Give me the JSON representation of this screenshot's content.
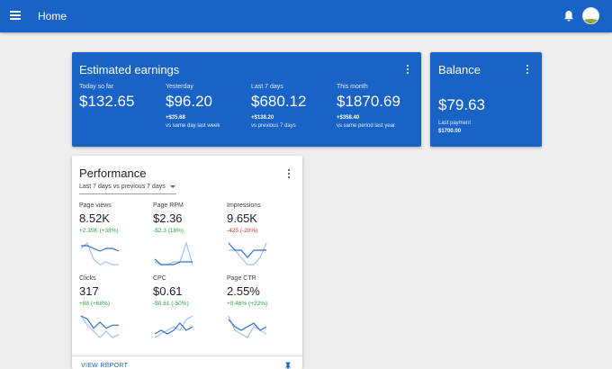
{
  "header": {
    "title": "Home"
  },
  "earnings": {
    "title": "Estimated earnings",
    "stats": [
      {
        "label": "Today so far",
        "value": "$132.65",
        "delta": "",
        "compare": ""
      },
      {
        "label": "Yesterday",
        "value": "$96.20",
        "delta": "+$35.68",
        "compare": "vs same day last week"
      },
      {
        "label": "Last 7 days",
        "value": "$680.12",
        "delta": "+$138.20",
        "compare": "vs previous 7 days"
      },
      {
        "label": "This month",
        "value": "$1870.69",
        "delta": "+$358.40",
        "compare": "vs same period last year"
      }
    ]
  },
  "balance": {
    "title": "Balance",
    "value": "$79.63",
    "last_payment_label": "Last payment",
    "last_payment_value": "$1700.00"
  },
  "performance": {
    "title": "Performance",
    "range_selector": "Last 7 days vs previous 7 days",
    "metrics": [
      {
        "label": "Page views",
        "value": "8.52K",
        "delta": "+2.35K (+38%)",
        "trend": "positive",
        "current": [
          8,
          8,
          7,
          6,
          7,
          7,
          6
        ],
        "previous": [
          7,
          9,
          3,
          1,
          2,
          1,
          1
        ]
      },
      {
        "label": "Page RPM",
        "value": "$2.36",
        "delta": "-$2.3 (18%)",
        "trend": "positive",
        "current": [
          4,
          2,
          2,
          2,
          3,
          3,
          3
        ],
        "previous": [
          3,
          2,
          2,
          3,
          3,
          10,
          2
        ]
      },
      {
        "label": "Impressions",
        "value": "9.65K",
        "delta": "-425 (-20%)",
        "trend": "negative",
        "current": [
          5,
          4,
          4,
          3,
          4,
          4,
          4
        ],
        "previous": [
          4,
          4,
          3,
          2,
          2,
          3,
          5
        ]
      },
      {
        "label": "Clicks",
        "value": "317",
        "delta": "+88 (+68%)",
        "trend": "positive",
        "current": [
          9,
          8,
          5,
          7,
          5,
          6,
          6
        ],
        "previous": [
          9,
          6,
          4,
          2,
          4,
          2,
          3
        ]
      },
      {
        "label": "CPC",
        "value": "$0.61",
        "delta": "-$0.61 (-50%)",
        "trend": "positive",
        "current": [
          3,
          4,
          3,
          4,
          6,
          4,
          5
        ],
        "previous": [
          2,
          3,
          4,
          5,
          4,
          7,
          8
        ]
      },
      {
        "label": "Page CTR",
        "value": "2.55%",
        "delta": "+0.46% (+22%)",
        "trend": "positive",
        "current": [
          7,
          5,
          4,
          5,
          6,
          4,
          5
        ],
        "previous": [
          8,
          4,
          3,
          2,
          5,
          4,
          3
        ]
      }
    ],
    "footer_link": "VIEW REPORT"
  },
  "colors": {
    "primary": "#1a63c6",
    "current_line": "#2f6fd4",
    "previous_line": "#9ec2f2",
    "positive": "#2e9e4f",
    "negative": "#d93025"
  },
  "icons": {
    "menu": "menu-icon",
    "notifications": "bell-icon",
    "more": "more-vert-icon",
    "dropdown": "arrow-drop-down-icon",
    "pin": "pin-icon"
  }
}
